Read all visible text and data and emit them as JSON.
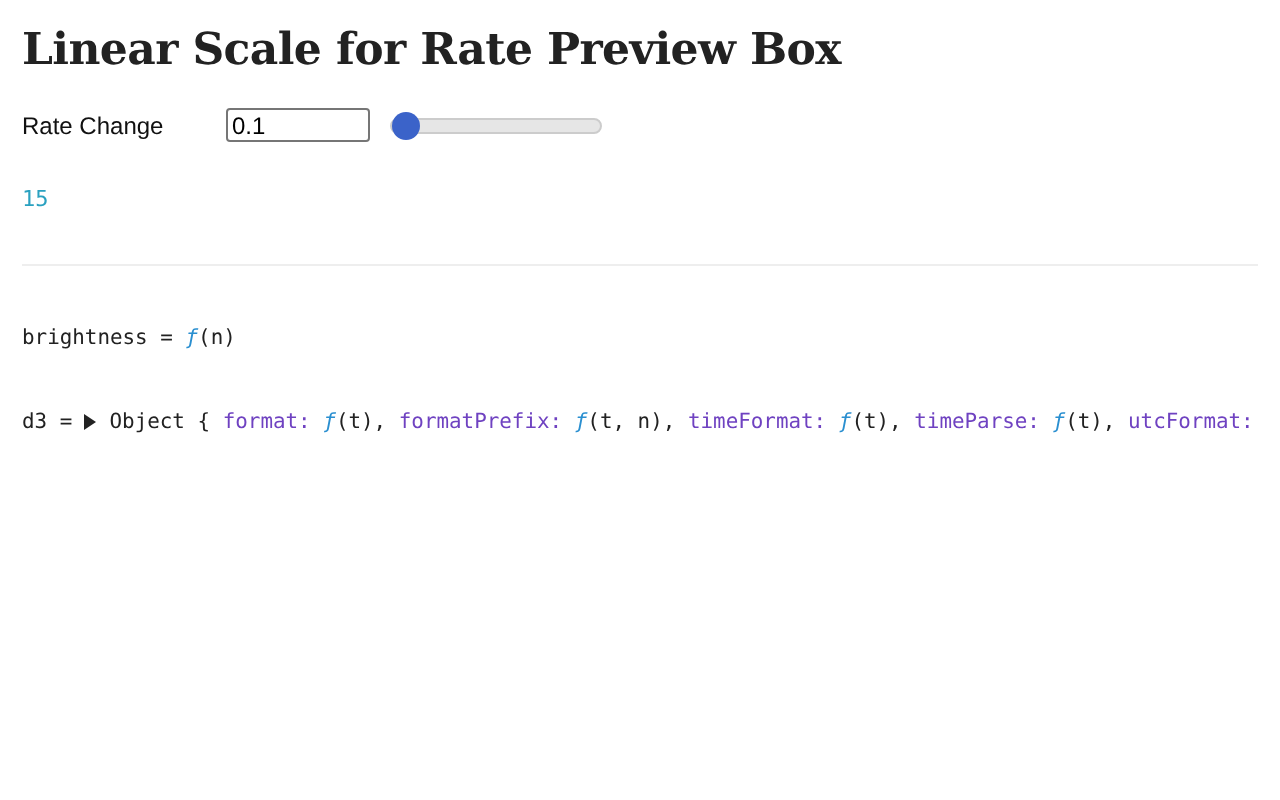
{
  "title": "Linear Scale for Rate Preview Box",
  "control": {
    "label": "Rate Change",
    "value": "0.1",
    "level": 0
  },
  "output": "15",
  "cells": [
    {
      "name": "brightness",
      "op": "=",
      "parts": [
        {
          "kind": "fn",
          "fn": "ƒ",
          "text": "(n)"
        }
      ]
    },
    {
      "name": "d3",
      "op": "=",
      "parts": [
        {
          "kind": "toggle",
          "expanded": false
        },
        {
          "kind": "plain",
          "text": "Object {"
        },
        {
          "kind": "key",
          "text": "format:"
        },
        {
          "kind": "fn",
          "fn": "ƒ",
          "text": "(t),"
        },
        {
          "kind": "key",
          "text": "formatPrefix:"
        },
        {
          "kind": "fn",
          "fn": "ƒ",
          "text": "(t, n),"
        },
        {
          "kind": "key",
          "text": "timeFormat:"
        },
        {
          "kind": "fn",
          "fn": "ƒ",
          "text": "(t),"
        },
        {
          "kind": "key",
          "text": "timeParse:"
        },
        {
          "kind": "fn",
          "fn": "ƒ",
          "text": "(t),"
        },
        {
          "kind": "key",
          "text": "utcFormat:"
        }
      ]
    }
  ]
}
